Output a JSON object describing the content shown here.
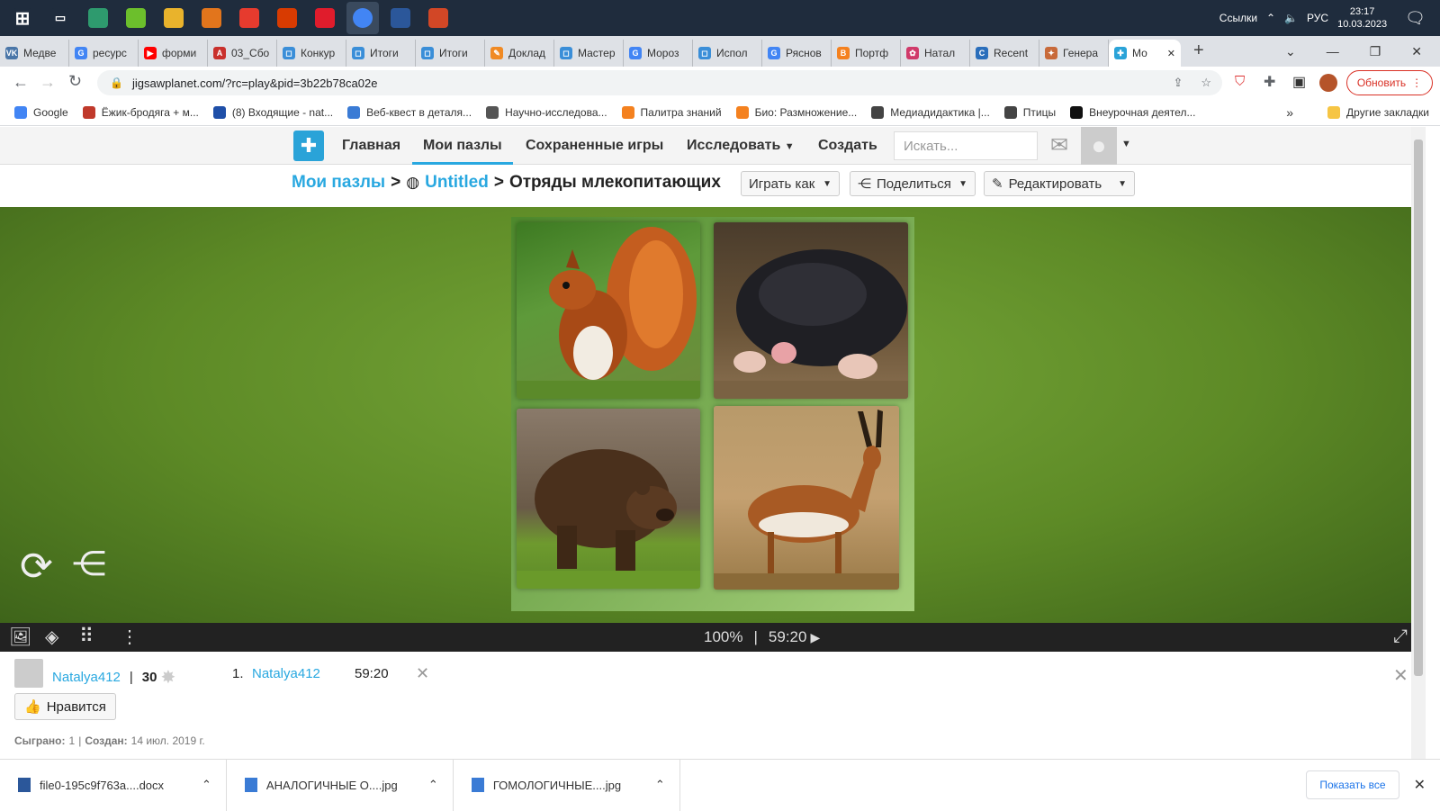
{
  "taskbar": {
    "tray_links": "Ссылки",
    "lang": "РУС",
    "time": "23:17",
    "date": "10.03.2023",
    "apps": [
      {
        "name": "windows-start-icon",
        "color": "#1f2c3d"
      },
      {
        "name": "task-view-icon",
        "color": "#1f2c3d"
      },
      {
        "name": "edge-icon",
        "color": "#2e9a6e"
      },
      {
        "name": "app-green-icon",
        "color": "#6cbf2c"
      },
      {
        "name": "file-explorer-icon",
        "color": "#e9b32c"
      },
      {
        "name": "browser-shield-icon",
        "color": "#e2751c"
      },
      {
        "name": "yandex-icon",
        "color": "#e63b2e"
      },
      {
        "name": "office-icon",
        "color": "#d83b01"
      },
      {
        "name": "opera-icon",
        "color": "#e01c2c"
      },
      {
        "name": "chrome-icon",
        "color": "#4285f4"
      },
      {
        "name": "word-icon",
        "color": "#2b579a"
      },
      {
        "name": "powerpoint-icon",
        "color": "#d24726"
      }
    ]
  },
  "tabs": [
    {
      "label": "Медве",
      "color": "#4a76a8",
      "glyph": "VK"
    },
    {
      "label": "ресурс",
      "color": "#4285f4",
      "glyph": "G"
    },
    {
      "label": "форми",
      "color": "#ff0000",
      "glyph": "▶"
    },
    {
      "label": "03_Сбо",
      "color": "#c9302c",
      "glyph": "A"
    },
    {
      "label": "Конкур",
      "color": "#3a8ed8",
      "glyph": "◻"
    },
    {
      "label": "Итоги",
      "color": "#3a8ed8",
      "glyph": "◻"
    },
    {
      "label": "Итоги",
      "color": "#3a8ed8",
      "glyph": "◻"
    },
    {
      "label": "Доклад",
      "color": "#f08a24",
      "glyph": "✎"
    },
    {
      "label": "Мастер",
      "color": "#3a8ed8",
      "glyph": "◻"
    },
    {
      "label": "Мороз",
      "color": "#4285f4",
      "glyph": "G"
    },
    {
      "label": "Испол",
      "color": "#3a8ed8",
      "glyph": "◻"
    },
    {
      "label": "Ряснов",
      "color": "#4285f4",
      "glyph": "G"
    },
    {
      "label": "Портф",
      "color": "#f4811f",
      "glyph": "B"
    },
    {
      "label": "Натал",
      "color": "#d03a6a",
      "glyph": "✿"
    },
    {
      "label": "Recent",
      "color": "#2a6ebb",
      "glyph": "C"
    },
    {
      "label": "Генера",
      "color": "#c86a3a",
      "glyph": "✦"
    }
  ],
  "active_tab": {
    "label": "Мо",
    "close": "✕"
  },
  "new_tab": "+",
  "window": {
    "minimize": "—",
    "restore": "❐",
    "close": "✕",
    "chevron": "⌄"
  },
  "address": {
    "url": "jigsawplanet.com/?rc=play&pid=3b22b78ca02e",
    "update_label": "Обновить"
  },
  "bookmarks": [
    {
      "label": "Google",
      "color": "#4285f4"
    },
    {
      "label": "Ёжик-бродяга + м...",
      "color": "#c0392b"
    },
    {
      "label": "(8) Входящие - nat...",
      "color": "#1f4fa8"
    },
    {
      "label": "Веб-квест в деталя...",
      "color": "#3a7bd5"
    },
    {
      "label": "Научно-исследова...",
      "color": "#555"
    },
    {
      "label": "Палитра знаний",
      "color": "#f4811f"
    },
    {
      "label": "Био: Размножение...",
      "color": "#f4811f"
    },
    {
      "label": "Медиадидактика |...",
      "color": "#444"
    },
    {
      "label": "Птицы",
      "color": "#444"
    },
    {
      "label": "Внеурочная деятел...",
      "color": "#111"
    }
  ],
  "bookmarks_more": "»",
  "other_bookmarks": "Другие закладки",
  "site_nav": {
    "home": "Главная",
    "my_puzzles": "Мои пазлы",
    "saved_games": "Сохраненные игры",
    "explore": "Исследовать",
    "create": "Создать",
    "search_placeholder": "Искать..."
  },
  "breadcrumb": {
    "root": "Мои пазлы",
    "sep1": ">",
    "folder": "Untitled",
    "sep2": ">",
    "title": "Отряды млекопитающих",
    "play_as": "Играть как",
    "share": "Поделиться",
    "edit": "Редактировать"
  },
  "puzzle": {
    "tiles": [
      "squirrel",
      "mole",
      "bear",
      "gazelle"
    ]
  },
  "controls": {
    "zoom": "100%",
    "sep": "|",
    "timer": "59:20"
  },
  "info": {
    "author": "Natalya412",
    "sep": "|",
    "score": "30",
    "leader_rank": "1.",
    "leader_name": "Natalya412",
    "leader_time": "59:20",
    "like": "Нравится",
    "played_label": "Сыграно:",
    "played_value": "1",
    "created_sep": "|",
    "created_label": "Создан:",
    "created_value": "14 июл. 2019 г."
  },
  "downloads": [
    {
      "name": "file0-195c9f763a....docx",
      "color": "#2b579a"
    },
    {
      "name": "АНАЛОГИЧНЫЕ О....jpg",
      "color": "#3a7bd5"
    },
    {
      "name": "ГОМОЛОГИЧНЫЕ....jpg",
      "color": "#3a7bd5"
    }
  ],
  "show_all": "Показать все"
}
